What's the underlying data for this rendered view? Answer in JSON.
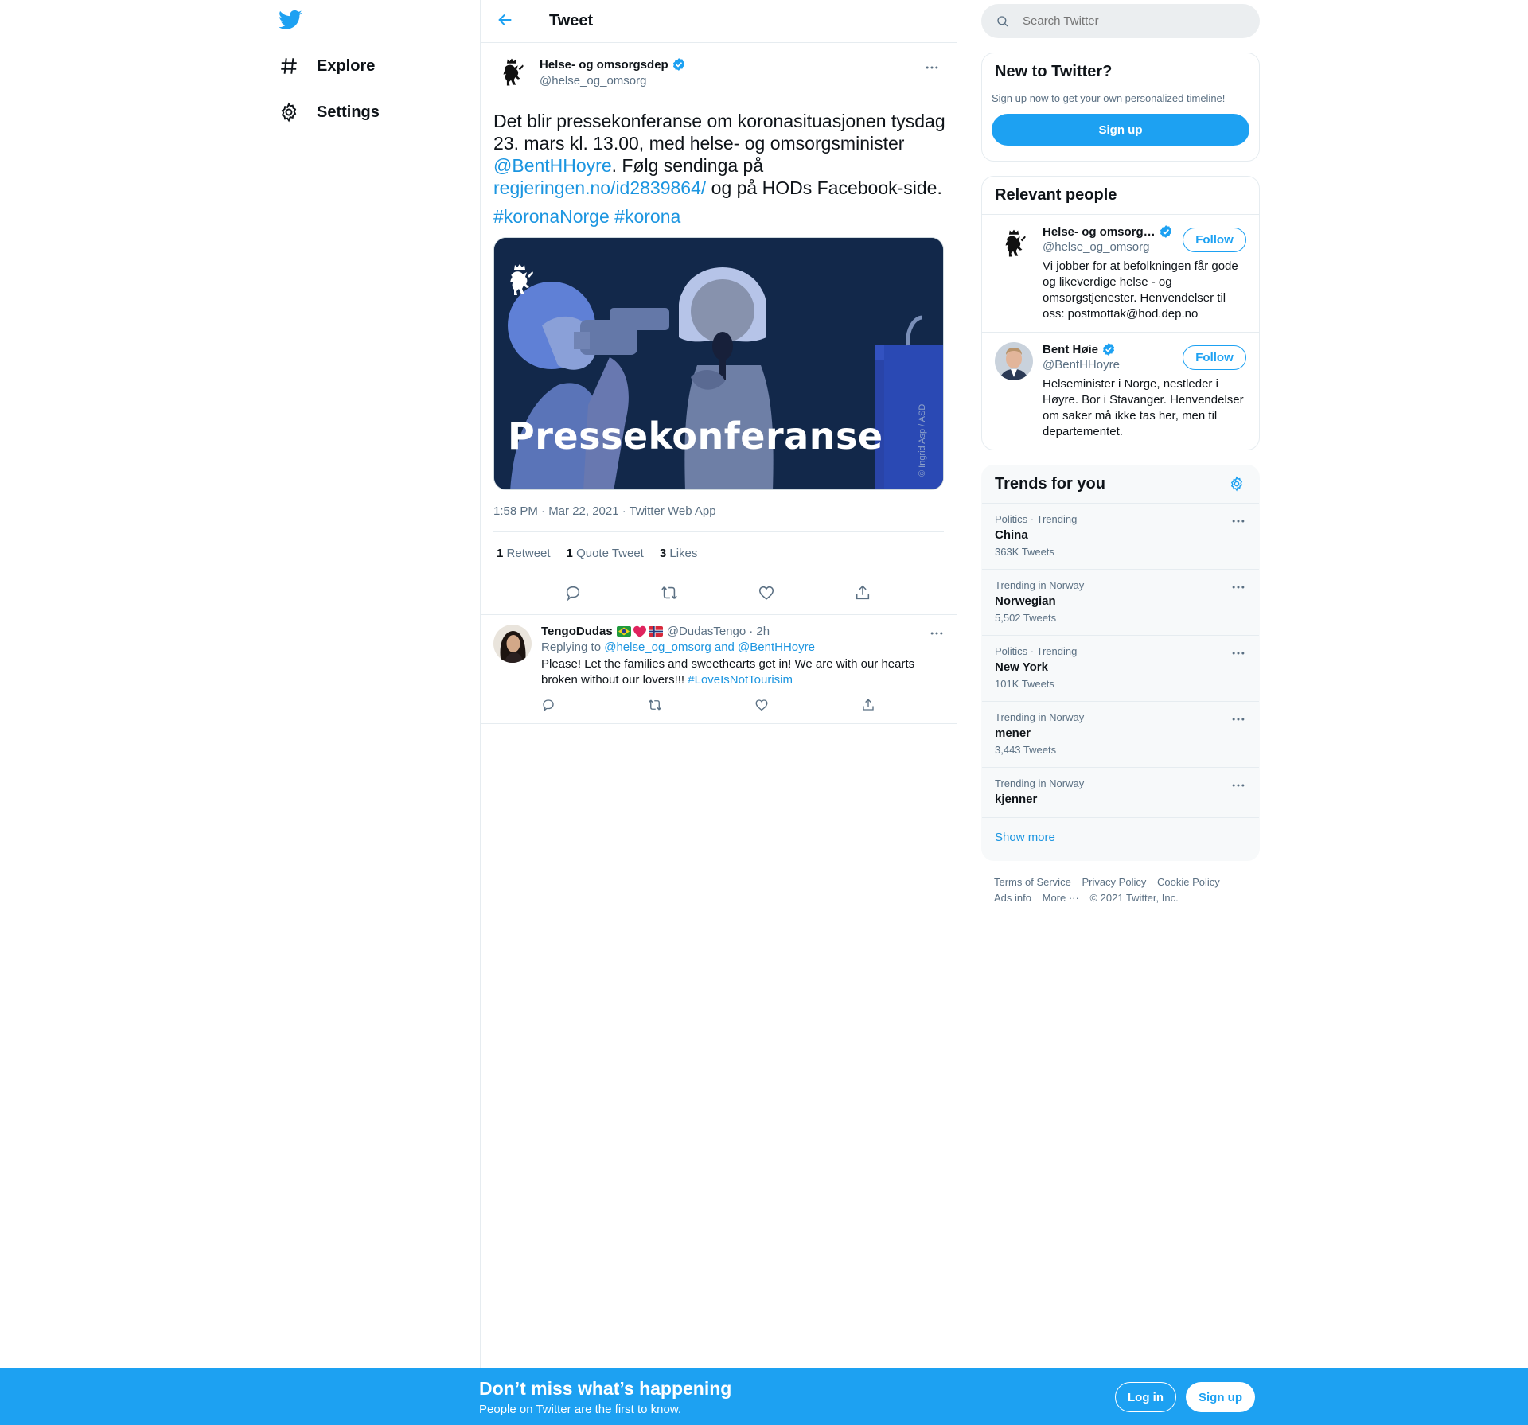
{
  "nav": {
    "explore_label": "Explore",
    "settings_label": "Settings"
  },
  "header": {
    "title": "Tweet"
  },
  "tweet": {
    "author_name": "Helse- og omsorgsdep",
    "author_handle": "@helse_og_omsorg",
    "text_1": "Det blir pressekonferanse om koronasituasjonen tysdag 23. mars kl. 13.00, med helse- og omsorgsminister ",
    "mention": "@BentHHoyre",
    "text_2": ". Følg sendinga på ",
    "link": "regjeringen.no/id2839864/",
    "text_3": " og på HODs Facebook-side.",
    "hashtag_1": "#koronaNorge",
    "hashtag_2": "#korona",
    "image_title": "Pressekonferanse",
    "image_credit": "© Ingrid Asp / ASD",
    "timestamp": "1:58 PM · Mar 22, 2021 · Twitter Web App",
    "retweets_count": "1",
    "retweets_label": "Retweet",
    "quotes_count": "1",
    "quotes_label": "Quote Tweet",
    "likes_count": "3",
    "likes_label": "Likes"
  },
  "reply": {
    "name": "TengoDudas",
    "handle": "@DudasTengo",
    "time": "· 2h",
    "replying_to_label": "Replying to",
    "replying_to_users": "@helse_og_omsorg and @BentHHoyre",
    "text": "Please! Let the families and sweethearts get in! We are with our hearts broken without our lovers!!! ",
    "hashtag": "#LoveIsNotTourisim"
  },
  "search": {
    "placeholder": "Search Twitter"
  },
  "new_to_twitter": {
    "title": "New to Twitter?",
    "subtitle": "Sign up now to get your own personalized timeline!",
    "signup_label": "Sign up"
  },
  "relevant_people": {
    "title": "Relevant people",
    "people": [
      {
        "name": "Helse- og omsorg…",
        "handle": "@helse_og_omsorg",
        "bio": "Vi jobber for at befolkningen får gode og likeverdige helse - og omsorgstjenester. Henvendelser til oss: postmottak@hod.dep.no",
        "follow_label": "Follow"
      },
      {
        "name": "Bent Høie",
        "handle": "@BentHHoyre",
        "bio": "Helseminister i Norge, nestleder i Høyre. Bor i Stavanger. Henvendelser om saker må ikke tas her, men til departementet.",
        "follow_label": "Follow"
      }
    ]
  },
  "trends": {
    "title": "Trends for you",
    "items": [
      {
        "meta": "Politics · Trending",
        "name": "China",
        "count": "363K Tweets"
      },
      {
        "meta": "Trending in Norway",
        "name": "Norwegian",
        "count": "5,502 Tweets"
      },
      {
        "meta": "Politics · Trending",
        "name": "New York",
        "count": "101K Tweets"
      },
      {
        "meta": "Trending in Norway",
        "name": "mener",
        "count": "3,443 Tweets"
      },
      {
        "meta": "Trending in Norway",
        "name": "kjenner",
        "count": ""
      }
    ],
    "show_more": "Show more"
  },
  "footer": {
    "terms": "Terms of Service",
    "privacy": "Privacy Policy",
    "cookie": "Cookie Policy",
    "ads": "Ads info",
    "more": "More ···",
    "copyright": "© 2021 Twitter, Inc."
  },
  "bottom_bar": {
    "title": "Don’t miss what’s happening",
    "subtitle": "People on Twitter are the first to know.",
    "login_label": "Log in",
    "signup_label": "Sign up"
  },
  "colors": {
    "brand": "#1da1f2",
    "link": "#1b95e0",
    "muted": "#5b7083",
    "image_bg": "#12284a"
  }
}
